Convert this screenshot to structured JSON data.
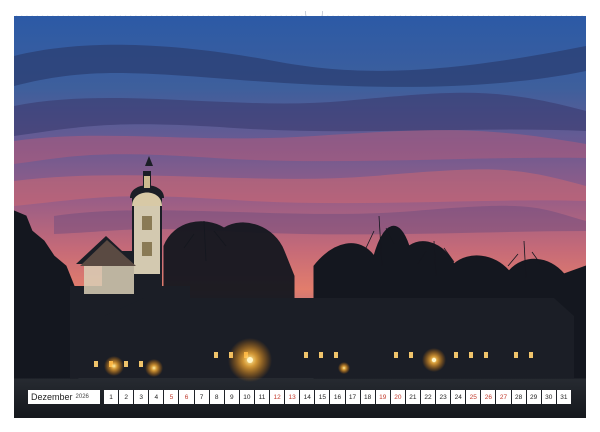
{
  "calendar": {
    "month": "Dezember",
    "year": "2026",
    "days": [
      {
        "label": "1",
        "weekend": false
      },
      {
        "label": "2",
        "weekend": false
      },
      {
        "label": "3",
        "weekend": false
      },
      {
        "label": "4",
        "weekend": false
      },
      {
        "label": "5",
        "weekend": true
      },
      {
        "label": "6",
        "weekend": true
      },
      {
        "label": "7",
        "weekend": false
      },
      {
        "label": "8",
        "weekend": false
      },
      {
        "label": "9",
        "weekend": false
      },
      {
        "label": "10",
        "weekend": false
      },
      {
        "label": "11",
        "weekend": false
      },
      {
        "label": "12",
        "weekend": true
      },
      {
        "label": "13",
        "weekend": true
      },
      {
        "label": "14",
        "weekend": false
      },
      {
        "label": "15",
        "weekend": false
      },
      {
        "label": "16",
        "weekend": false
      },
      {
        "label": "17",
        "weekend": false
      },
      {
        "label": "18",
        "weekend": false
      },
      {
        "label": "19",
        "weekend": true
      },
      {
        "label": "20",
        "weekend": true
      },
      {
        "label": "21",
        "weekend": false
      },
      {
        "label": "22",
        "weekend": false
      },
      {
        "label": "23",
        "weekend": false
      },
      {
        "label": "24",
        "weekend": false
      },
      {
        "label": "25",
        "weekend": true
      },
      {
        "label": "26",
        "weekend": true
      },
      {
        "label": "27",
        "weekend": true
      },
      {
        "label": "28",
        "weekend": false
      },
      {
        "label": "29",
        "weekend": false
      },
      {
        "label": "30",
        "weekend": false
      },
      {
        "label": "31",
        "weekend": false
      }
    ]
  },
  "colors": {
    "sky_top": "#2f5ea8",
    "sky_mid": "#7a5a8e",
    "sky_glow": "#e0706a",
    "silhouette": "#161a22",
    "lamp": "#ffb53a",
    "weekend_text": "#c0392b"
  }
}
